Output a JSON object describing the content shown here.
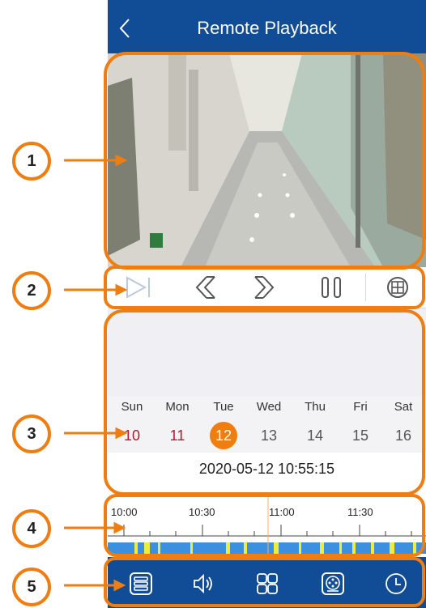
{
  "header": {
    "title": "Remote Playback"
  },
  "icons": {
    "back": "chevron-left-icon",
    "controls": [
      "play-icon",
      "rewind-icon",
      "fast-forward-icon",
      "pause-icon",
      "layout-grid-icon"
    ],
    "bottom": [
      "storage-icon",
      "speaker-icon",
      "split-view-icon",
      "film-reel-icon",
      "clock-icon"
    ]
  },
  "calendar": {
    "weekdays": [
      "Sun",
      "Mon",
      "Tue",
      "Wed",
      "Thu",
      "Fri",
      "Sat"
    ],
    "days": [
      "10",
      "11",
      "12",
      "13",
      "14",
      "15",
      "16"
    ],
    "selected_day": "12",
    "datetime": "2020-05-12 10:55:15"
  },
  "timeline": {
    "labels": [
      "10:00",
      "10:30",
      "11:00",
      "11:30"
    ]
  },
  "callouts": [
    "1",
    "2",
    "3",
    "4",
    "5"
  ],
  "colors": {
    "header": "#114d96",
    "accent": "#f07d10",
    "weekend_red": "#b8182a",
    "recording_blue": "#3d8fe0",
    "event_yellow": "#f0ec3a"
  }
}
